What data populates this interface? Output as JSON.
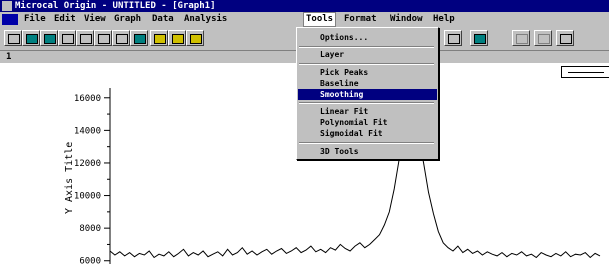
{
  "window": {
    "title": "Microcal Origin - UNTITLED - [Graph1]"
  },
  "menubar": {
    "items": [
      {
        "label": "File"
      },
      {
        "label": "Edit"
      },
      {
        "label": "View"
      },
      {
        "label": "Graph"
      },
      {
        "label": "Data"
      },
      {
        "label": "Analysis"
      },
      {
        "label": "Tools"
      },
      {
        "label": "Format"
      },
      {
        "label": "Window"
      },
      {
        "label": "Help"
      }
    ],
    "open_menu": "Tools"
  },
  "toolbar": {
    "buttons": [
      {
        "icon": "new-document-icon"
      },
      {
        "icon": "new-worksheet-icon"
      },
      {
        "icon": "new-graph-icon"
      },
      {
        "icon": "new-matrix-icon"
      },
      {
        "icon": "new-layout-icon"
      },
      {
        "icon": "new-function-icon"
      },
      {
        "icon": "open-icon"
      },
      {
        "icon": "open-template-icon"
      },
      {
        "icon": "open-project-icon"
      },
      {
        "icon": "save-icon"
      },
      {
        "icon": "save-template-icon"
      },
      {
        "icon": "import-icon"
      },
      {
        "icon": "print-icon"
      },
      {
        "icon": "layout-icon"
      },
      {
        "icon": "palette-icon"
      },
      {
        "icon": "cut-icon"
      },
      {
        "icon": "copy-icon"
      },
      {
        "icon": "paste-icon"
      }
    ]
  },
  "tab": {
    "label": "1"
  },
  "tools_menu": {
    "items": [
      {
        "label": "Options...",
        "selected": false
      },
      {
        "label": "Layer",
        "selected": false
      },
      {
        "label": "Pick Peaks",
        "selected": false
      },
      {
        "label": "Baseline",
        "selected": false
      },
      {
        "label": "Smoothing",
        "selected": true
      },
      {
        "label": "Linear Fit",
        "selected": false
      },
      {
        "label": "Polynomial Fit",
        "selected": false
      },
      {
        "label": "Sigmoidal Fit",
        "selected": false
      },
      {
        "label": "3D Tools",
        "selected": false
      }
    ]
  },
  "graph": {
    "ylabel": "Y Axis Title",
    "yticks": [
      "16000",
      "14000",
      "12000",
      "10000",
      "8000",
      "6000"
    ],
    "colors": {
      "line": "#000000",
      "background": "#ffffff",
      "selection": "#000080"
    }
  },
  "chart_data": {
    "type": "line",
    "title": "",
    "xlabel": "",
    "ylabel": "Y Axis Title",
    "ylim": [
      5800,
      16600
    ],
    "xlim": [
      0,
      100
    ],
    "grid": false,
    "series": [
      {
        "x": [
          0,
          1,
          2,
          3,
          4,
          5,
          6,
          7,
          8,
          9,
          10,
          11,
          12,
          13,
          14,
          15,
          16,
          17,
          18,
          19,
          20,
          21,
          22,
          23,
          24,
          25,
          26,
          27,
          28,
          29,
          30,
          31,
          32,
          33,
          34,
          35,
          36,
          37,
          38,
          39,
          40,
          41,
          42,
          43,
          44,
          45,
          46,
          47,
          48,
          49,
          50,
          51,
          52,
          53,
          54,
          55,
          56,
          57,
          58,
          59,
          60,
          61,
          62,
          63,
          64,
          65,
          66,
          67,
          68,
          69,
          70,
          71,
          72,
          73,
          74,
          75,
          76,
          77,
          78,
          79,
          80,
          81,
          82,
          83,
          84,
          85,
          86,
          87,
          88,
          89,
          90,
          91,
          92,
          93,
          94,
          95,
          96,
          97,
          98,
          99,
          100
        ],
        "values": [
          6600,
          6350,
          6550,
          6300,
          6500,
          6250,
          6450,
          6350,
          6600,
          6200,
          6400,
          6300,
          6550,
          6250,
          6450,
          6700,
          6300,
          6500,
          6350,
          6600,
          6250,
          6400,
          6550,
          6300,
          6700,
          6350,
          6500,
          6800,
          6400,
          6600,
          6350,
          6550,
          6700,
          6400,
          6600,
          6750,
          6450,
          6600,
          6800,
          6500,
          6650,
          6900,
          6550,
          6700,
          6500,
          6800,
          6650,
          7000,
          6750,
          6600,
          6900,
          7100,
          6800,
          7000,
          7300,
          7600,
          8200,
          9000,
          10400,
          12200,
          13800,
          14900,
          14600,
          13500,
          12000,
          10200,
          8900,
          7800,
          7100,
          6800,
          6600,
          6900,
          6500,
          6700,
          6450,
          6600,
          6350,
          6550,
          6400,
          6300,
          6500,
          6250,
          6450,
          6350,
          6550,
          6300,
          6400,
          6200,
          6500,
          6350,
          6250,
          6450,
          6300,
          6550,
          6250,
          6400,
          6350,
          6500,
          6200,
          6450,
          6300
        ]
      }
    ]
  }
}
